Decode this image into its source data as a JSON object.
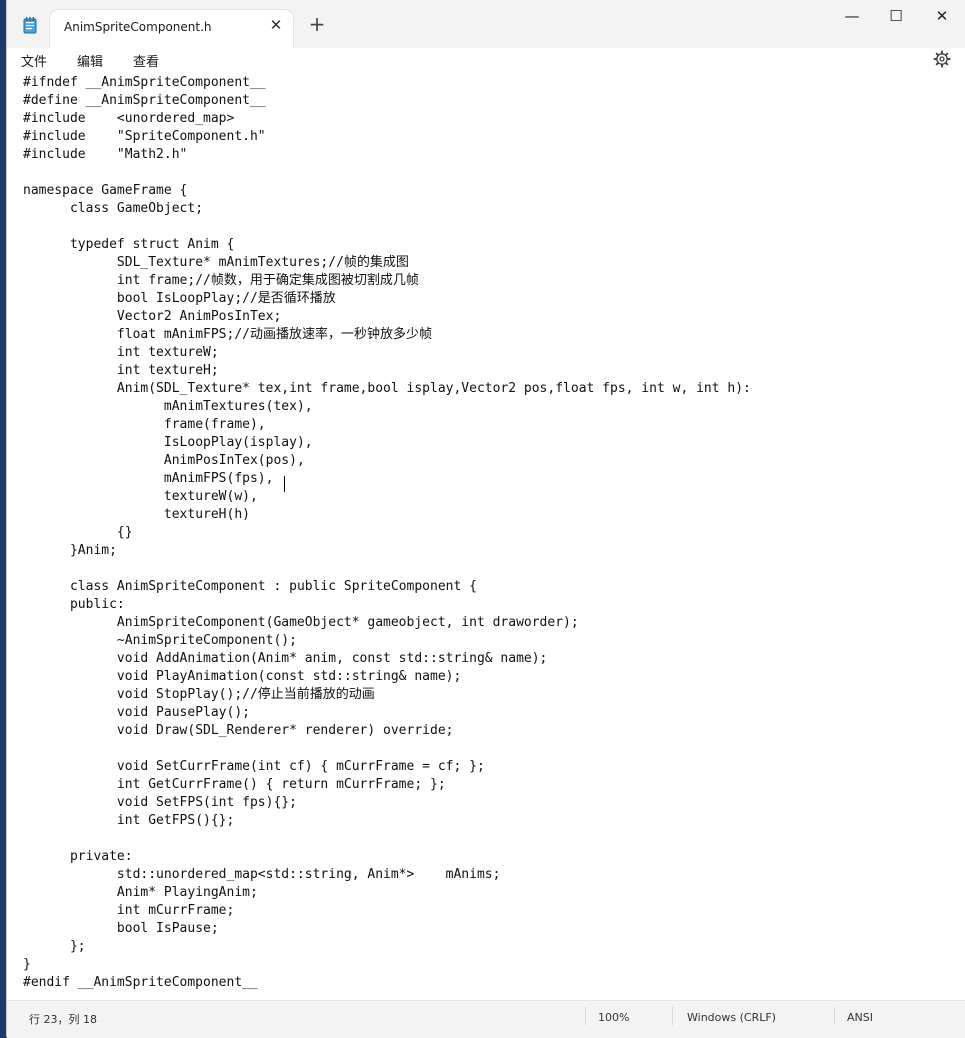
{
  "window": {
    "tab_title": "AnimSpriteComponent.h",
    "tab_close_glyph": "✕",
    "new_tab_glyph": "+",
    "minimize_glyph": "—",
    "maximize_glyph": "☐",
    "close_glyph": "✕"
  },
  "menu": {
    "file": "文件",
    "edit": "编辑",
    "view": "查看"
  },
  "editor": {
    "content": "#ifndef __AnimSpriteComponent__\n#define __AnimSpriteComponent__\n#include\t<unordered_map>\n#include\t\"SpriteComponent.h\"\n#include\t\"Math2.h\"\n\nnamespace GameFrame {\n\tclass GameObject;\n\n\ttypedef struct Anim {\n\t\tSDL_Texture* mAnimTextures;//帧的集成图\n\t\tint frame;//帧数，用于确定集成图被切割成几帧\n\t\tbool IsLoopPlay;//是否循环播放\n\t\tVector2 AnimPosInTex;\n\t\tfloat mAnimFPS;//动画播放速率，一秒钟放多少帧\n\t\tint textureW;\n\t\tint textureH;\n\t\tAnim(SDL_Texture* tex,int frame,bool isplay,Vector2 pos,float fps, int w, int h):\n\t\t\tmAnimTextures(tex),\n\t\t\tframe(frame),\n\t\t\tIsLoopPlay(isplay),\n\t\t\tAnimPosInTex(pos),\n\t\t\tmAnimFPS(fps),\n\t\t\ttextureW(w),\n\t\t\ttextureH(h)\n\t\t{}\n\t}Anim;\n\n\tclass AnimSpriteComponent : public SpriteComponent {\n\tpublic:\n\t\tAnimSpriteComponent(GameObject* gameobject, int draworder);\n\t\t~AnimSpriteComponent();\n\t\tvoid AddAnimation(Anim* anim, const std::string& name);\n\t\tvoid PlayAnimation(const std::string& name);\n\t\tvoid StopPlay();//停止当前播放的动画\n\t\tvoid PausePlay();\n\t\tvoid Draw(SDL_Renderer* renderer) override;\n\n\t\tvoid SetCurrFrame(int cf) { mCurrFrame = cf; };\n\t\tint GetCurrFrame() { return mCurrFrame; };\n\t\tvoid SetFPS(int fps){};\n\t\tint GetFPS(){};\n\n\tprivate:\n\t\tstd::unordered_map<std::string, Anim*>\tmAnims;\n\t\tAnim* PlayingAnim;\n\t\tint mCurrFrame;\n\t\tbool IsPause;\n\t};\n}\n#endif __AnimSpriteComponent__"
  },
  "status": {
    "position": "行 23，列 18",
    "zoom": "100%",
    "line_ending": "Windows (CRLF)",
    "encoding": "ANSI"
  }
}
